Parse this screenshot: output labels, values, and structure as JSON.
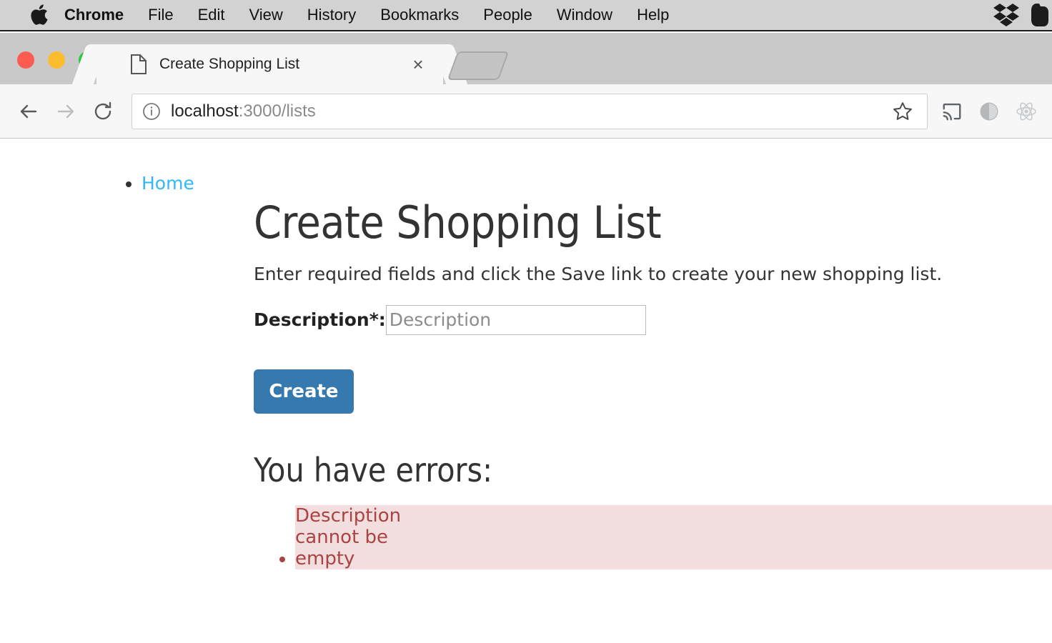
{
  "menubar": {
    "apple_icon": "apple-logo",
    "items": [
      {
        "label": "Chrome",
        "bold": true
      },
      {
        "label": "File"
      },
      {
        "label": "Edit"
      },
      {
        "label": "View"
      },
      {
        "label": "History"
      },
      {
        "label": "Bookmarks"
      },
      {
        "label": "People"
      },
      {
        "label": "Window"
      },
      {
        "label": "Help"
      }
    ],
    "tray": [
      {
        "icon": "dropbox-icon"
      },
      {
        "icon": "evernote-icon"
      }
    ]
  },
  "browser": {
    "tab": {
      "favicon": "page-document-icon",
      "title": "Create Shopping List",
      "close_label": "×"
    },
    "new_tab_label": "",
    "toolbar": {
      "back_icon": "arrow-left-icon",
      "forward_icon": "arrow-right-icon",
      "reload_icon": "reload-icon",
      "info_icon": "info-circle-icon",
      "url_primary": "localhost",
      "url_secondary": ":3000/lists",
      "star_icon": "star-icon",
      "cast_icon": "cast-icon",
      "avatar_icon": "profile-circle-icon",
      "react_icon": "react-devtools-icon"
    }
  },
  "page": {
    "breadcrumb": {
      "home_label": "Home",
      "link_color": "#32b8f7"
    },
    "title": "Create Shopping List",
    "intro": "Enter required fields and click the Save link to create your new shopping list.",
    "form": {
      "description_label": "Description*:",
      "description_value": "",
      "description_placeholder": "Description",
      "submit_label": "Create",
      "submit_color": "#3579ae"
    },
    "errors": {
      "heading": "You have errors:",
      "items": [
        "Description cannot be empty"
      ],
      "text_color": "#a94442",
      "background_color": "#f2dede"
    }
  }
}
